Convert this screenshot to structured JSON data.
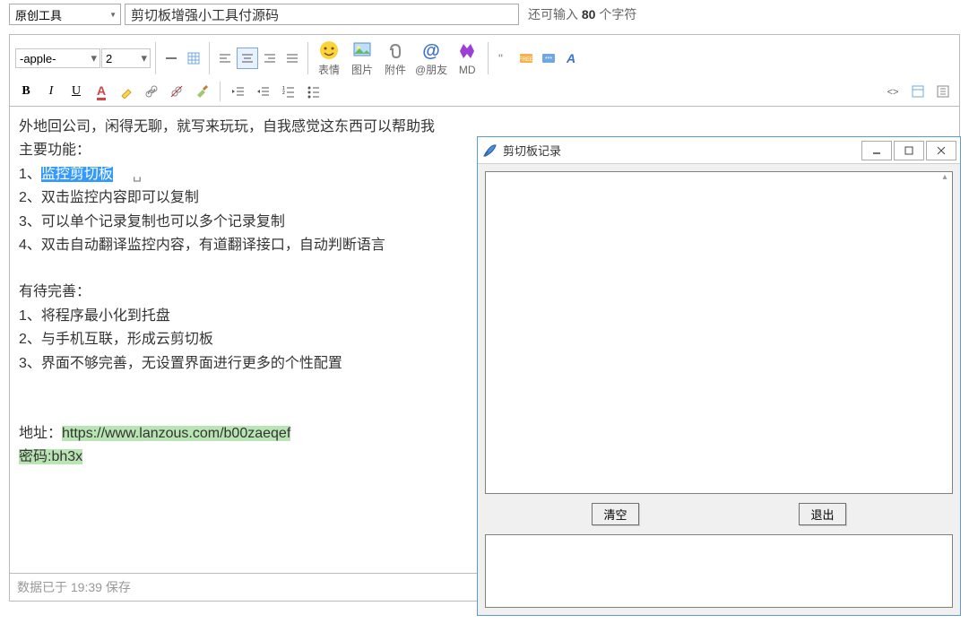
{
  "top": {
    "category": "原创工具",
    "title_value": "剪切板增强小工具付源码",
    "char_prefix": "还可输入 ",
    "char_count": "80",
    "char_suffix": " 个字符"
  },
  "toolbar": {
    "font_family": "-apple-",
    "font_size": "2",
    "labels": {
      "emoji": "表情",
      "image": "图片",
      "attach": "附件",
      "at": "@朋友",
      "md": "MD"
    }
  },
  "content": {
    "l1": "外地回公司，闲得无聊，就写来玩玩，自我感觉这东西可以帮助我",
    "l2": "主要功能：",
    "l3a": "1、",
    "l3b": "监控剪切板",
    "l4": "2、双击监控内容即可以复制",
    "l5": "3、可以单个记录复制也可以多个记录复制",
    "l6": "4、双击自动翻译监控内容，有道翻译接口，自动判断语言",
    "l7": "有待完善：",
    "l8": "1、将程序最小化到托盘",
    "l9": "2、与手机互联，形成云剪切板",
    "l10": "3、界面不够完善，无设置界面进行更多的个性配置",
    "l11a": "地址：",
    "l11b": "https://www.lanzous.com/b00zaeqef",
    "l12": "密码:bh3x"
  },
  "status": "数据已于 19:39 保存",
  "window": {
    "title": "剪切板记录",
    "clear": "清空",
    "exit": "退出"
  }
}
